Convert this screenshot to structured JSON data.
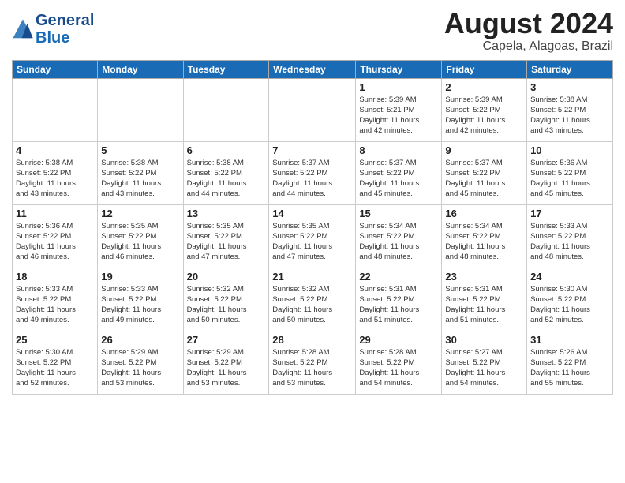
{
  "logo": {
    "line1": "General",
    "line2": "Blue"
  },
  "title": "August 2024",
  "subtitle": "Capela, Alagoas, Brazil",
  "days_of_week": [
    "Sunday",
    "Monday",
    "Tuesday",
    "Wednesday",
    "Thursday",
    "Friday",
    "Saturday"
  ],
  "weeks": [
    [
      {
        "day": "",
        "info": ""
      },
      {
        "day": "",
        "info": ""
      },
      {
        "day": "",
        "info": ""
      },
      {
        "day": "",
        "info": ""
      },
      {
        "day": "1",
        "info": "Sunrise: 5:39 AM\nSunset: 5:21 PM\nDaylight: 11 hours\nand 42 minutes."
      },
      {
        "day": "2",
        "info": "Sunrise: 5:39 AM\nSunset: 5:22 PM\nDaylight: 11 hours\nand 42 minutes."
      },
      {
        "day": "3",
        "info": "Sunrise: 5:38 AM\nSunset: 5:22 PM\nDaylight: 11 hours\nand 43 minutes."
      }
    ],
    [
      {
        "day": "4",
        "info": "Sunrise: 5:38 AM\nSunset: 5:22 PM\nDaylight: 11 hours\nand 43 minutes."
      },
      {
        "day": "5",
        "info": "Sunrise: 5:38 AM\nSunset: 5:22 PM\nDaylight: 11 hours\nand 43 minutes."
      },
      {
        "day": "6",
        "info": "Sunrise: 5:38 AM\nSunset: 5:22 PM\nDaylight: 11 hours\nand 44 minutes."
      },
      {
        "day": "7",
        "info": "Sunrise: 5:37 AM\nSunset: 5:22 PM\nDaylight: 11 hours\nand 44 minutes."
      },
      {
        "day": "8",
        "info": "Sunrise: 5:37 AM\nSunset: 5:22 PM\nDaylight: 11 hours\nand 45 minutes."
      },
      {
        "day": "9",
        "info": "Sunrise: 5:37 AM\nSunset: 5:22 PM\nDaylight: 11 hours\nand 45 minutes."
      },
      {
        "day": "10",
        "info": "Sunrise: 5:36 AM\nSunset: 5:22 PM\nDaylight: 11 hours\nand 45 minutes."
      }
    ],
    [
      {
        "day": "11",
        "info": "Sunrise: 5:36 AM\nSunset: 5:22 PM\nDaylight: 11 hours\nand 46 minutes."
      },
      {
        "day": "12",
        "info": "Sunrise: 5:35 AM\nSunset: 5:22 PM\nDaylight: 11 hours\nand 46 minutes."
      },
      {
        "day": "13",
        "info": "Sunrise: 5:35 AM\nSunset: 5:22 PM\nDaylight: 11 hours\nand 47 minutes."
      },
      {
        "day": "14",
        "info": "Sunrise: 5:35 AM\nSunset: 5:22 PM\nDaylight: 11 hours\nand 47 minutes."
      },
      {
        "day": "15",
        "info": "Sunrise: 5:34 AM\nSunset: 5:22 PM\nDaylight: 11 hours\nand 48 minutes."
      },
      {
        "day": "16",
        "info": "Sunrise: 5:34 AM\nSunset: 5:22 PM\nDaylight: 11 hours\nand 48 minutes."
      },
      {
        "day": "17",
        "info": "Sunrise: 5:33 AM\nSunset: 5:22 PM\nDaylight: 11 hours\nand 48 minutes."
      }
    ],
    [
      {
        "day": "18",
        "info": "Sunrise: 5:33 AM\nSunset: 5:22 PM\nDaylight: 11 hours\nand 49 minutes."
      },
      {
        "day": "19",
        "info": "Sunrise: 5:33 AM\nSunset: 5:22 PM\nDaylight: 11 hours\nand 49 minutes."
      },
      {
        "day": "20",
        "info": "Sunrise: 5:32 AM\nSunset: 5:22 PM\nDaylight: 11 hours\nand 50 minutes."
      },
      {
        "day": "21",
        "info": "Sunrise: 5:32 AM\nSunset: 5:22 PM\nDaylight: 11 hours\nand 50 minutes."
      },
      {
        "day": "22",
        "info": "Sunrise: 5:31 AM\nSunset: 5:22 PM\nDaylight: 11 hours\nand 51 minutes."
      },
      {
        "day": "23",
        "info": "Sunrise: 5:31 AM\nSunset: 5:22 PM\nDaylight: 11 hours\nand 51 minutes."
      },
      {
        "day": "24",
        "info": "Sunrise: 5:30 AM\nSunset: 5:22 PM\nDaylight: 11 hours\nand 52 minutes."
      }
    ],
    [
      {
        "day": "25",
        "info": "Sunrise: 5:30 AM\nSunset: 5:22 PM\nDaylight: 11 hours\nand 52 minutes."
      },
      {
        "day": "26",
        "info": "Sunrise: 5:29 AM\nSunset: 5:22 PM\nDaylight: 11 hours\nand 53 minutes."
      },
      {
        "day": "27",
        "info": "Sunrise: 5:29 AM\nSunset: 5:22 PM\nDaylight: 11 hours\nand 53 minutes."
      },
      {
        "day": "28",
        "info": "Sunrise: 5:28 AM\nSunset: 5:22 PM\nDaylight: 11 hours\nand 53 minutes."
      },
      {
        "day": "29",
        "info": "Sunrise: 5:28 AM\nSunset: 5:22 PM\nDaylight: 11 hours\nand 54 minutes."
      },
      {
        "day": "30",
        "info": "Sunrise: 5:27 AM\nSunset: 5:22 PM\nDaylight: 11 hours\nand 54 minutes."
      },
      {
        "day": "31",
        "info": "Sunrise: 5:26 AM\nSunset: 5:22 PM\nDaylight: 11 hours\nand 55 minutes."
      }
    ]
  ]
}
